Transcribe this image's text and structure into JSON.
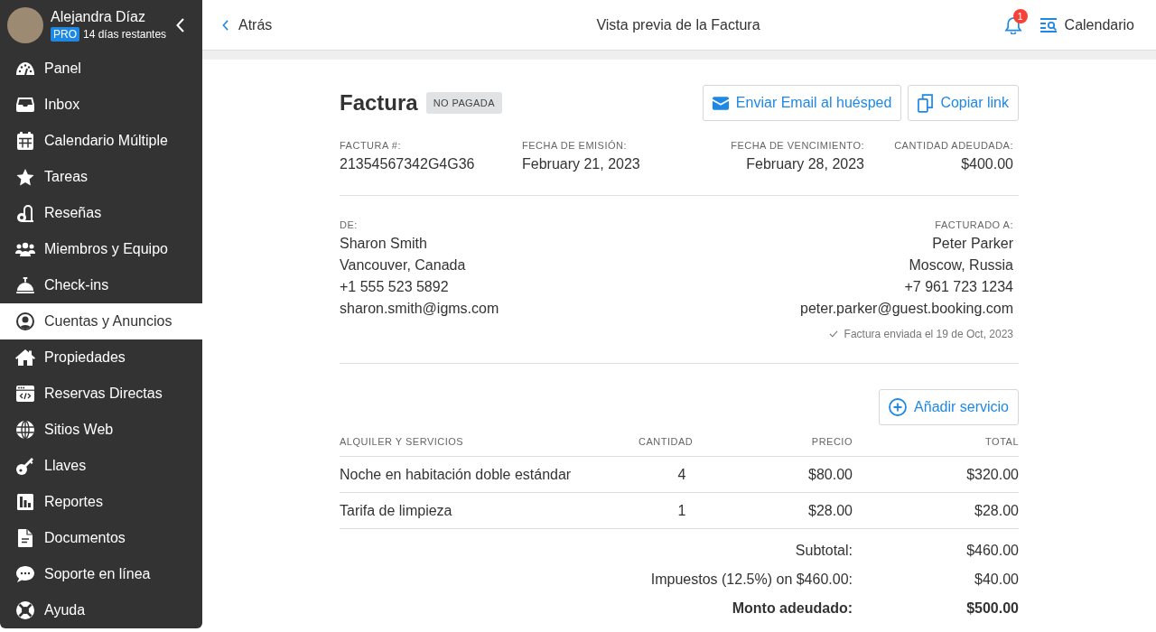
{
  "sidebar": {
    "user": {
      "name": "Alejandra Díaz",
      "plan_badge": "PRO",
      "trial_status": "14 días restantes"
    },
    "items": [
      {
        "label": "Panel",
        "selected": false
      },
      {
        "label": "Inbox",
        "selected": false
      },
      {
        "label": "Calendario Múltiple",
        "selected": false
      },
      {
        "label": "Tareas",
        "selected": false
      },
      {
        "label": "Reseñas",
        "selected": false
      },
      {
        "label": "Miembros y Equipo",
        "selected": false
      },
      {
        "label": "Check-ins",
        "selected": false
      },
      {
        "label": "Cuentas y Anuncios",
        "selected": true
      },
      {
        "label": "Propiedades",
        "selected": false
      },
      {
        "label": "Reservas Directas",
        "selected": false
      },
      {
        "label": "Sitios Web",
        "selected": false
      },
      {
        "label": "Llaves",
        "selected": false
      },
      {
        "label": "Reportes",
        "selected": false
      },
      {
        "label": "Documentos",
        "selected": false
      },
      {
        "label": "Soporte en línea",
        "selected": false
      },
      {
        "label": "Ayuda",
        "selected": false
      }
    ]
  },
  "top_bar": {
    "back_label": "Atrás",
    "title": "Vista previa de la Factura",
    "notification_count": "1",
    "calendar_label": "Calendario"
  },
  "invoice": {
    "title": "Factura",
    "status_badge": "NO PAGADA",
    "actions": [
      {
        "kind": "email",
        "label": "Enviar Email al huésped"
      },
      {
        "kind": "copy",
        "label": "Copiar link"
      }
    ],
    "details": [
      {
        "label": "FACTURA #:",
        "value": "21354567342G4G36"
      },
      {
        "label": "FECHA DE EMISIÓN:",
        "value": "February 21, 2023"
      },
      {
        "label": "FECHA DE VENCIMIENTO:",
        "value": "February 28, 2023"
      },
      {
        "label": "CANTIDAD ADEUDADA:",
        "value": "$400.00"
      }
    ],
    "from": {
      "label": "DE:",
      "lines": [
        "Sharon Smith",
        "Vancouver, Canada",
        "+1 555 523 5892",
        "sharon.smith@igms.com"
      ]
    },
    "billed_to": {
      "label": "FACTURADO A:",
      "lines": [
        "Peter Parker",
        "Moscow, Russia",
        "+7 961 723 1234",
        "peter.parker@guest.booking.com"
      ],
      "sent_note": "Factura enviada el 19 de Oct, 2023"
    },
    "add_service_label": "Añadir servicio",
    "table": {
      "columns": [
        "ALQUILER Y SERVICIOS",
        "CANTIDAD",
        "PRECIO",
        "TOTAL"
      ],
      "rows": [
        [
          "Noche en habitación doble estándar",
          "4",
          "$80.00",
          "$320.00"
        ],
        [
          "Tarifa de limpieza",
          "1",
          "$28.00",
          "$28.00"
        ]
      ]
    },
    "totals": [
      {
        "kind": "line",
        "label": "Subtotal:",
        "value": "$460.00"
      },
      {
        "kind": "line",
        "label": "Impuestos (12.5%) on $460.00:",
        "value": "$40.00"
      },
      {
        "kind": "grand_total",
        "label": "Monto adeudado:",
        "value": "$500.00"
      }
    ]
  }
}
